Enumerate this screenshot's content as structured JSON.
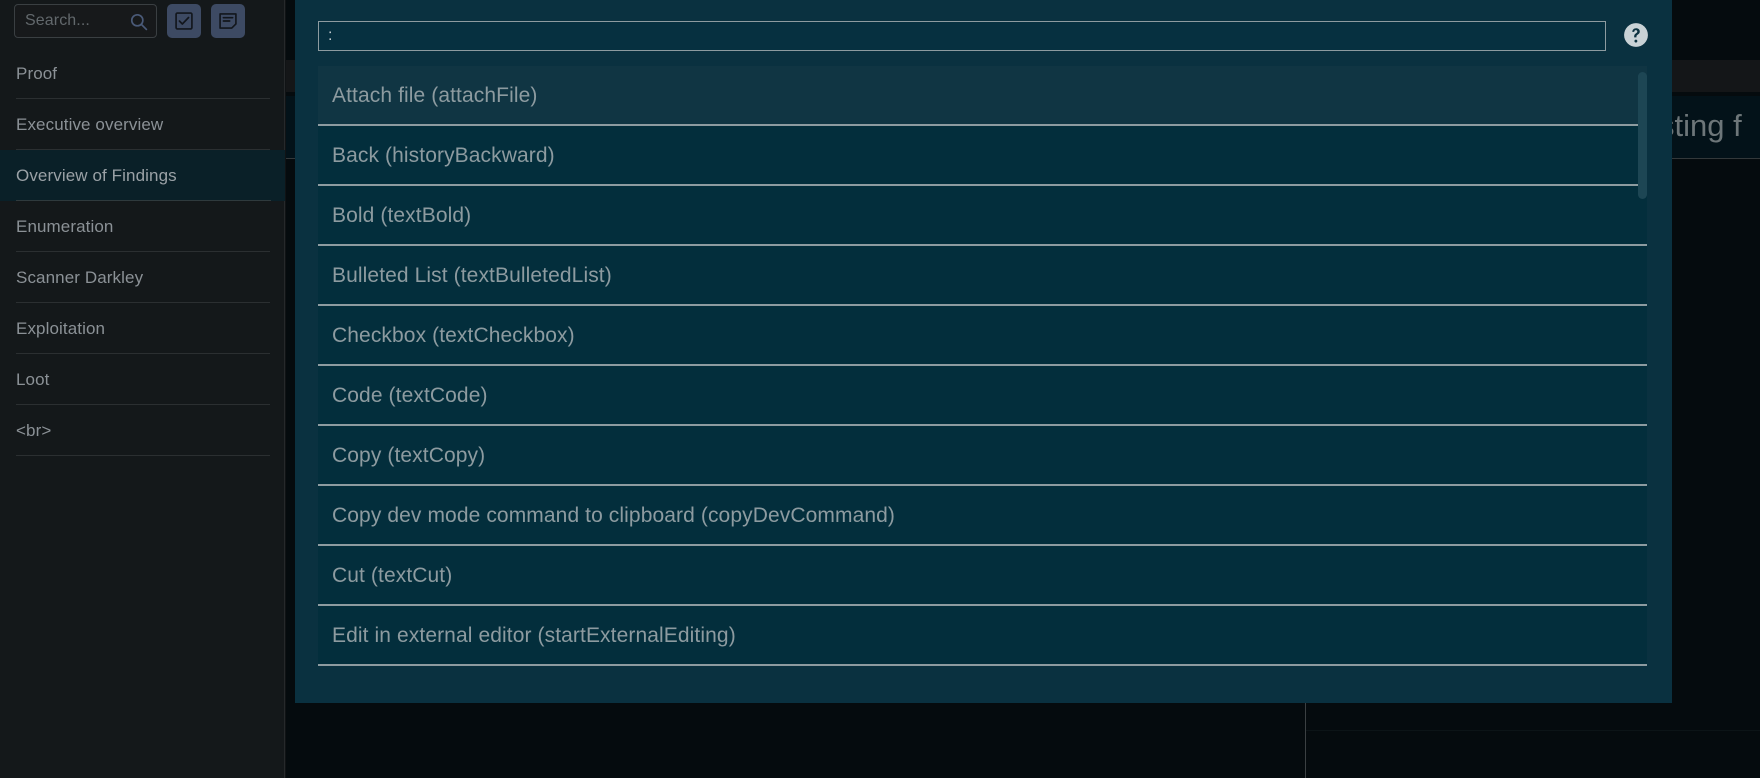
{
  "sidebar": {
    "search": {
      "placeholder": "Search...",
      "icon": "search-icon"
    },
    "buttons": [
      {
        "name": "checklist-button",
        "icon": "checkbox-icon"
      },
      {
        "name": "notes-button",
        "icon": "note-icon"
      }
    ],
    "items": [
      {
        "label": "Proof",
        "active": false
      },
      {
        "label": "Executive overview",
        "active": false
      },
      {
        "label": "Overview of Findings",
        "active": true
      },
      {
        "label": "Enumeration",
        "active": false
      },
      {
        "label": "Scanner Darkley",
        "active": false
      },
      {
        "label": "Exploitation",
        "active": false
      },
      {
        "label": "Loot",
        "active": false
      },
      {
        "label": "<br>",
        "active": false
      }
    ]
  },
  "page": {
    "title": "Overview of Findings",
    "heading": "sting f"
  },
  "modal": {
    "search": {
      "value": ":",
      "placeholder": ""
    },
    "help_icon": "help-circle-icon",
    "options": [
      {
        "label": "Attach file (attachFile)",
        "selected": true
      },
      {
        "label": "Back (historyBackward)",
        "selected": false
      },
      {
        "label": "Bold (textBold)",
        "selected": false
      },
      {
        "label": "Bulleted List (textBulletedList)",
        "selected": false
      },
      {
        "label": "Checkbox (textCheckbox)",
        "selected": false
      },
      {
        "label": "Code (textCode)",
        "selected": false
      },
      {
        "label": "Copy (textCopy)",
        "selected": false
      },
      {
        "label": "Copy dev mode command to clipboard (copyDevCommand)",
        "selected": false
      },
      {
        "label": "Cut (textCut)",
        "selected": false
      },
      {
        "label": "Edit in external editor (startExternalEditing)",
        "selected": false
      }
    ]
  },
  "colors": {
    "modal_bg": "#0a3140",
    "option_bg": "#032e3c",
    "option_selected_bg": "#103543",
    "text": "#8d9ba0",
    "sidebar_bg": "#14181a",
    "accent_button": "#3d4a63"
  }
}
